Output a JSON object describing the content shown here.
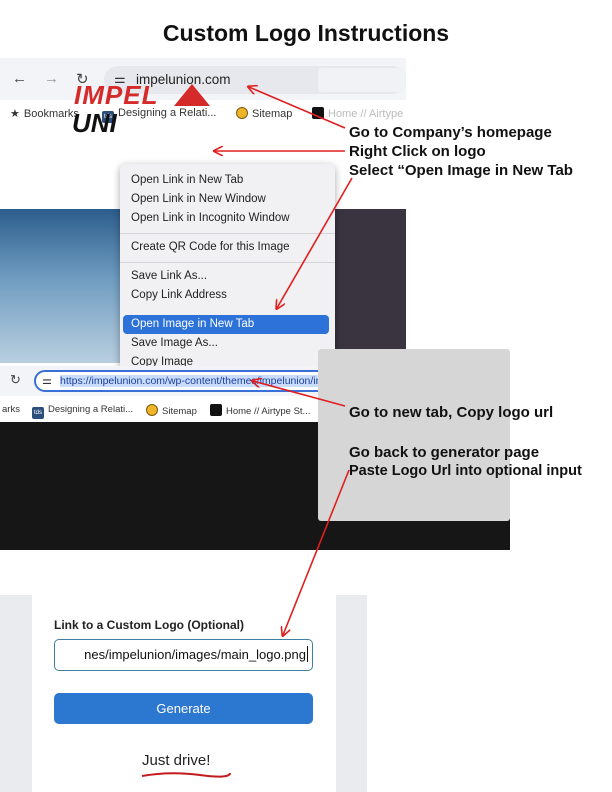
{
  "title": "Custom Logo Instructions",
  "browser1": {
    "nav": {
      "back": "←",
      "forward": "→",
      "reload": "↻",
      "tune": "⚌"
    },
    "url": "impelunion.com",
    "bookmarks": [
      "Bookmarks",
      "Designing a Relati...",
      "Sitemap",
      "Home // Airtype"
    ],
    "site_logo": {
      "line1": "IMPEL",
      "line2": "UNI"
    },
    "context_menu": {
      "items": [
        "Open Link in New Tab",
        "Open Link in New Window",
        "Open Link in Incognito Window",
        "Create QR Code for this Image",
        "Save Link As...",
        "Copy Link Address",
        "Open Image in New Tab",
        "Save Image As...",
        "Copy Image"
      ],
      "highlighted": "Open Image in New Tab"
    }
  },
  "browser2": {
    "url": "https://impelunion.com/wp-content/themes/impelunion/images/main_logo.png",
    "bookmarks": [
      "arks",
      "Designing a Relati...",
      "Sitemap",
      "Home // Airtype St..."
    ]
  },
  "instructions": {
    "step1": "Go to Company’s homepage",
    "step2": "Right Click on logo",
    "step3": "Select “Open Image in New Tab",
    "step4": "Go to new tab, Copy logo url",
    "step5": "Go back to generator page",
    "step6": "Paste Logo Url into optional input"
  },
  "form": {
    "label": "Link to a Custom Logo (Optional)",
    "input_value": "nes/impelunion/images/main_logo.png",
    "button": "Generate",
    "tagline": "Just drive!"
  },
  "colors": {
    "arrow": "#e01e1e",
    "primary_button": "#2c77d0",
    "highlight": "#2d72d9"
  }
}
